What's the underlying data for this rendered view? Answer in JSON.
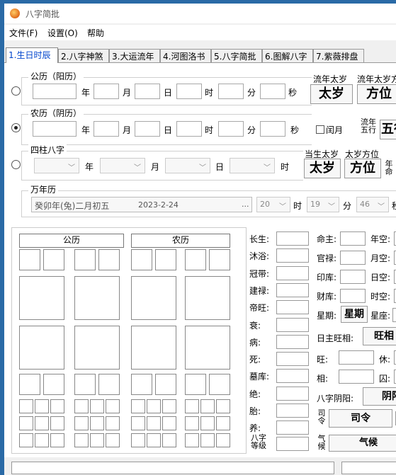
{
  "window": {
    "title": "八字简批"
  },
  "menu": [
    "文件(F)",
    "设置(O)",
    "帮助"
  ],
  "tabs": [
    "1.生日时辰",
    "2.八字神煞",
    "3.大运流年",
    "4.河图洛书",
    "5.八字简批",
    "6.图解八字",
    "7.紫薇排盘"
  ],
  "gregorian": {
    "group": "公历（阳历）",
    "year": "年",
    "month": "月",
    "day": "日",
    "hour": "时",
    "minute": "分",
    "second": "秒",
    "selected": false
  },
  "lunar": {
    "group": "农历（阴历）",
    "year": "年",
    "month": "月",
    "day": "日",
    "hour": "时",
    "minute": "分",
    "second": "秒",
    "leap_month": "闰月",
    "selected": true
  },
  "pillars": {
    "group": "四柱八字",
    "year": "年",
    "month": "月",
    "day": "日",
    "hour": "时",
    "selected": false
  },
  "right_top": {
    "flow_year_taisui_label": "流年太岁",
    "flow_year_taisui_dir_label": "流年太岁方",
    "taisui_btn": "太岁",
    "fangwei_btn": "方位",
    "flow_year_wuxing_label": "流年五行",
    "wuxing_btn": "五行",
    "birth_taisui_label": "当生太岁",
    "taisui_dir_label": "太岁方位",
    "birth_taisui_btn": "太岁",
    "birth_fangwei_btn": "方位",
    "year_life_label": "年命"
  },
  "calendar": {
    "group": "万年历",
    "date_text": "癸卯年(兔)二月初五",
    "date_value": "2023-2-24",
    "more_btn": "...",
    "hour_value": "20",
    "hour_label": "时",
    "minute_value": "19",
    "minute_label": "分",
    "second_value": "46",
    "second_label": "秒"
  },
  "chart": {
    "gregorian_header": "公历",
    "lunar_header": "农历"
  },
  "stages": [
    "长生:",
    "沐浴:",
    "冠带:",
    "建禄:",
    "帝旺:",
    "衰:",
    "病:",
    "死:",
    "墓库:",
    "绝:",
    "胎:",
    "养:"
  ],
  "bazi_grade": "八字等级",
  "info_left": [
    "命主:",
    "官禄:",
    "印库:",
    "财库:"
  ],
  "info_right": [
    "年空:",
    "月空:",
    "日空:",
    "时空:"
  ],
  "xingqi": {
    "label": "星期:",
    "btn": "星期",
    "label2": "星座:"
  },
  "rizhu": {
    "label": "日主旺相:",
    "btn": "旺相"
  },
  "wang": "旺:",
  "xiu": "休:",
  "xiang": "相:",
  "qiu": "囚:",
  "yinyang": {
    "label": "八字阴阳:",
    "btn": "阴阳"
  },
  "siling": {
    "label": "司令",
    "btn": "司令"
  },
  "qihou": {
    "label": "气候",
    "btn": "气候"
  }
}
